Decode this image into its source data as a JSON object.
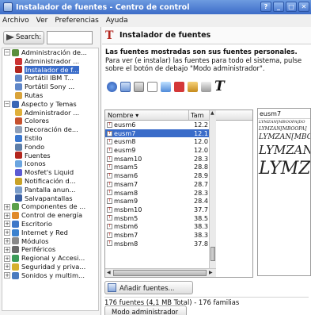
{
  "window": {
    "title": "Instalador de fuentes - Centro de control",
    "buttons": [
      "?",
      "_",
      "□",
      "✕"
    ]
  },
  "menu": [
    "Archivo",
    "Ver",
    "Preferencias",
    "Ayuda"
  ],
  "search": {
    "button_label": "Search:",
    "value": ""
  },
  "tree": [
    {
      "label": "Administración de...",
      "expander": "−",
      "indent": 0,
      "color": "#5a8f3c"
    },
    {
      "label": "Administrador ...",
      "expander": "",
      "indent": 1,
      "color": "#c33"
    },
    {
      "label": "Instalador de f...",
      "expander": "",
      "indent": 1,
      "color": "#b3261e",
      "selected": true
    },
    {
      "label": "Portátil IBM T...",
      "expander": "",
      "indent": 1,
      "color": "#5f86c8"
    },
    {
      "label": "Portátil Sony ...",
      "expander": "",
      "indent": 1,
      "color": "#5f86c8"
    },
    {
      "label": "Rutas",
      "expander": "",
      "indent": 1,
      "color": "#d9a33a"
    },
    {
      "label": "Aspecto y Temas",
      "expander": "−",
      "indent": 0,
      "color": "#3b67b5"
    },
    {
      "label": "Administrador ...",
      "expander": "",
      "indent": 1,
      "color": "#e0b03a"
    },
    {
      "label": "Colores",
      "expander": "",
      "indent": 1,
      "color": "#c6512e"
    },
    {
      "label": "Decoración de...",
      "expander": "",
      "indent": 1,
      "color": "#8f9fb8"
    },
    {
      "label": "Estilo",
      "expander": "",
      "indent": 1,
      "color": "#3b78d0"
    },
    {
      "label": "Fondo",
      "expander": "",
      "indent": 1,
      "color": "#5e7ea8"
    },
    {
      "label": "Fuentes",
      "expander": "",
      "indent": 1,
      "color": "#b3261e"
    },
    {
      "label": "Iconos",
      "expander": "",
      "indent": 1,
      "color": "#6aa5e0"
    },
    {
      "label": "Mosfet's Liquid",
      "expander": "",
      "indent": 1,
      "color": "#5b5bd3"
    },
    {
      "label": "Notificación d...",
      "expander": "",
      "indent": 1,
      "color": "#c9a227"
    },
    {
      "label": "Pantalla anun...",
      "expander": "",
      "indent": 1,
      "color": "#7a9cc9"
    },
    {
      "label": "Salvapantallas",
      "expander": "",
      "indent": 1,
      "color": "#3a5fa2"
    },
    {
      "label": "Componentes de ...",
      "expander": "+",
      "indent": 0,
      "color": "#5aa04a"
    },
    {
      "label": "Control de energía",
      "expander": "+",
      "indent": 0,
      "color": "#e08a2a"
    },
    {
      "label": "Escritorio",
      "expander": "+",
      "indent": 0,
      "color": "#3f78c8"
    },
    {
      "label": "Internet y Red",
      "expander": "+",
      "indent": 0,
      "color": "#3c82cf"
    },
    {
      "label": "Módulos",
      "expander": "+",
      "indent": 0,
      "color": "#8a8a8a"
    },
    {
      "label": "Periféricos",
      "expander": "+",
      "indent": 0,
      "color": "#6b6b6b"
    },
    {
      "label": "Regional y Accesi...",
      "expander": "+",
      "indent": 0,
      "color": "#3b9b58"
    },
    {
      "label": "Seguridad y priva...",
      "expander": "+",
      "indent": 0,
      "color": "#d6b02e"
    },
    {
      "label": "Sonidos y multim...",
      "expander": "+",
      "indent": 0,
      "color": "#4a7bbf"
    }
  ],
  "panel": {
    "title": "Instalador de fuentes",
    "desc_bold": "Las fuentes mostradas son sus fuentes personales.",
    "desc_rest": "Para ver (e instalar) las fuentes para todo el sistema, pulse sobre el botón de debajo \"Modo administrador\"."
  },
  "list": {
    "col_name": "Nombre",
    "col_size": "Tam",
    "rows": [
      {
        "name": "eusm6",
        "size": "12.2"
      },
      {
        "name": "eusm7",
        "size": "12.1",
        "selected": true
      },
      {
        "name": "eusm8",
        "size": "12.0"
      },
      {
        "name": "eusm9",
        "size": "12.0"
      },
      {
        "name": "msam10",
        "size": "28.3"
      },
      {
        "name": "msam5",
        "size": "28.8"
      },
      {
        "name": "msam6",
        "size": "28.9"
      },
      {
        "name": "msam7",
        "size": "28.7"
      },
      {
        "name": "msam8",
        "size": "28.3"
      },
      {
        "name": "msam9",
        "size": "28.4"
      },
      {
        "name": "msbm10",
        "size": "37.7"
      },
      {
        "name": "msbm5",
        "size": "38.5"
      },
      {
        "name": "msbm6",
        "size": "38.3"
      },
      {
        "name": "msbm7",
        "size": "38.3"
      },
      {
        "name": "msbm8",
        "size": "37.8"
      }
    ]
  },
  "preview": {
    "font_name": "eusm7",
    "lines": [
      "LYMZAN[MBOOPA]DO",
      "LYMZAN[MBOOPA]",
      "LYMZAN[MBOO",
      "LYMZAN",
      "LYMZ"
    ]
  },
  "add_button": "Añadir fuentes...",
  "status": "176 fuentes (4,1 MB Total) - 176 familias",
  "admin_button": "Modo administrador"
}
